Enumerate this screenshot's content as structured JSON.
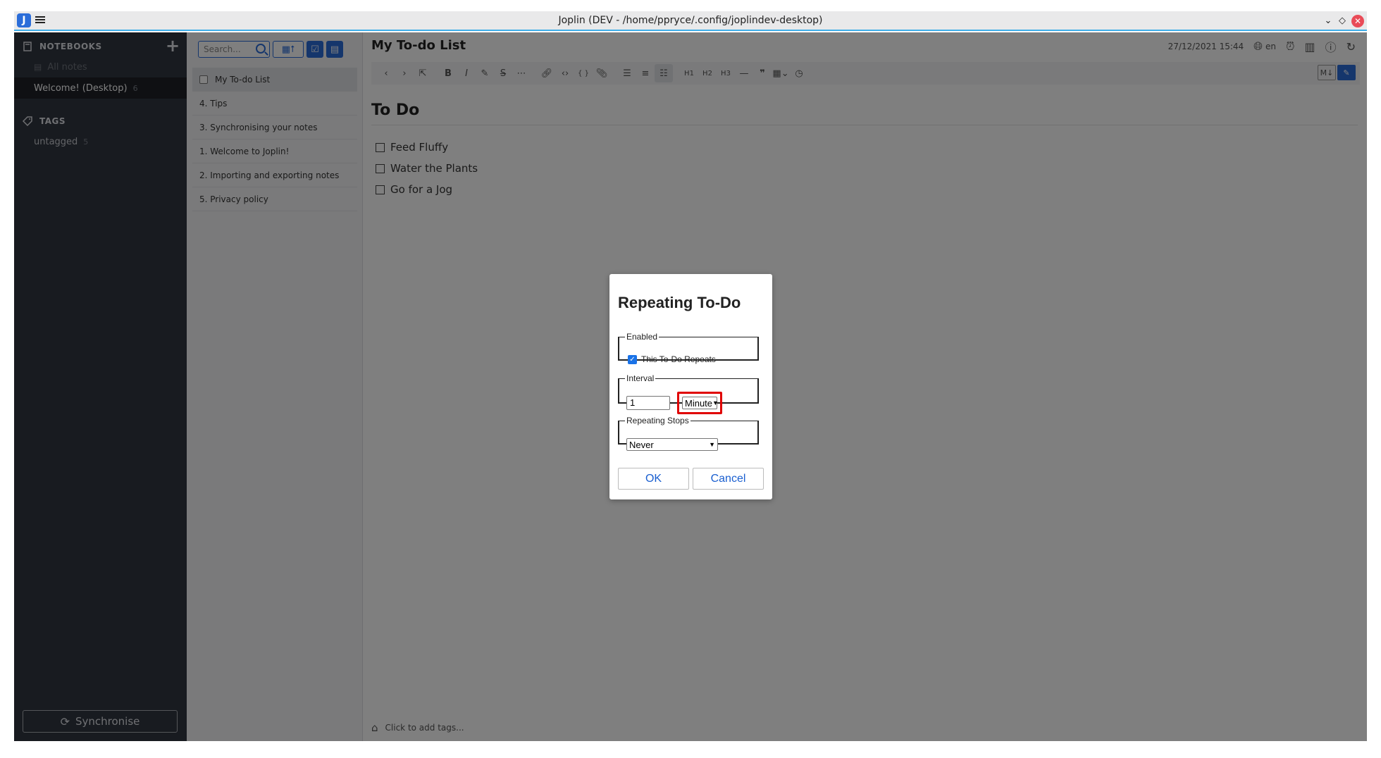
{
  "window": {
    "title": "Joplin (DEV - /home/ppryce/.config/joplindev-desktop)",
    "app_icon": "J"
  },
  "sidebar": {
    "notebooks_header": "NOTEBOOKS",
    "all_notes": "All notes",
    "notebooks": [
      {
        "label": "Welcome! (Desktop)",
        "count": "6"
      }
    ],
    "tags_header": "TAGS",
    "tags": [
      {
        "label": "untagged",
        "count": "5"
      }
    ],
    "sync_label": "Synchronise"
  },
  "note_list": {
    "search_placeholder": "Search...",
    "notes": [
      {
        "title": "My To-do List",
        "is_todo": true
      },
      {
        "title": "4. Tips"
      },
      {
        "title": "3. Synchronising your notes"
      },
      {
        "title": "1. Welcome to Joplin!"
      },
      {
        "title": "2. Importing and exporting notes"
      },
      {
        "title": "5. Privacy policy"
      }
    ]
  },
  "editor": {
    "note_title": "My To-do List",
    "timestamp": "27/12/2021 15:44",
    "language": "en",
    "heading": "To Do",
    "tasks": [
      "Feed Fluffy",
      "Water the Plants",
      "Go for a Jog"
    ],
    "toolbar": {
      "h1": "H1",
      "h2": "H2",
      "h3": "H3"
    },
    "footer_tags": "Click to add tags..."
  },
  "dialog": {
    "title": "Repeating To-Do",
    "enabled_legend": "Enabled",
    "repeats_label": "This To-Do Repeats",
    "repeats_checked": true,
    "interval_legend": "Interval",
    "interval_value": "1",
    "interval_unit": "Minute",
    "stops_legend": "Repeating Stops",
    "stops_value": "Never",
    "ok_label": "OK",
    "cancel_label": "Cancel"
  },
  "colors": {
    "accent": "#2b6dd9",
    "sidebar_bg": "#313640",
    "highlight_box": "#e00000"
  }
}
